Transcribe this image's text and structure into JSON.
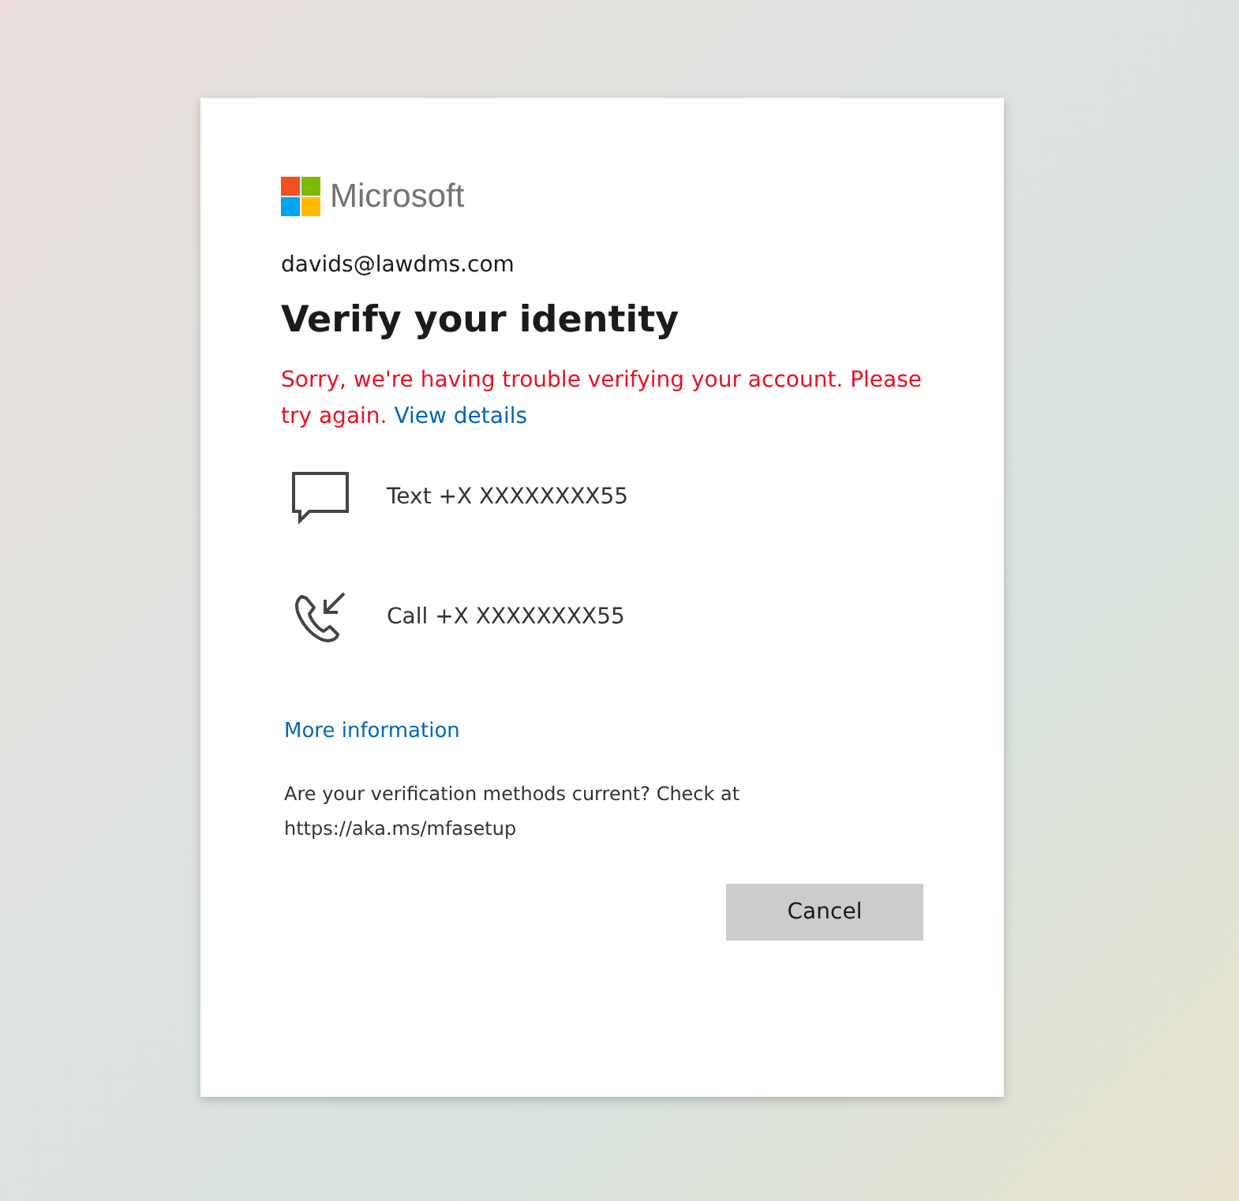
{
  "logo": {
    "text": "Microsoft"
  },
  "account": "davids@lawdms.com",
  "title": "Verify your identity",
  "error": {
    "message": "Sorry, we're having trouble verifying your account. Please try again.",
    "link": "View details"
  },
  "methods": [
    {
      "kind": "text",
      "label": "Text +X XXXXXXXX55"
    },
    {
      "kind": "call",
      "label": "Call +X XXXXXXXX55"
    }
  ],
  "more_info_link": "More information",
  "footer_note": "Are your verification methods current? Check at https://aka.ms/mfasetup",
  "buttons": [
    "Cancel"
  ]
}
